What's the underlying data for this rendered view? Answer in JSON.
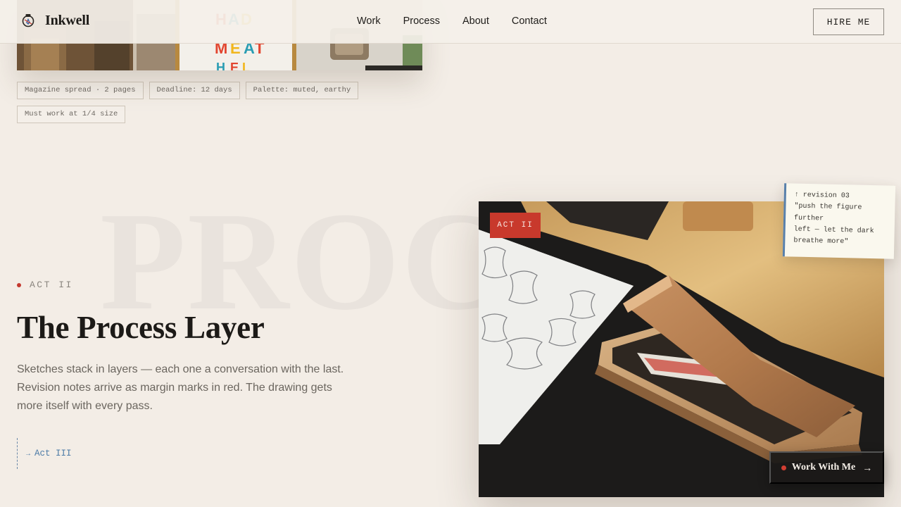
{
  "header": {
    "brand": "Inkwell",
    "logo_icon": "ink-bottle-icon",
    "nav": [
      {
        "label": "Work"
      },
      {
        "label": "Process"
      },
      {
        "label": "About"
      },
      {
        "label": "Contact"
      }
    ],
    "cta_label": "HIRE ME"
  },
  "project_tags": [
    "Magazine spread · 2 pages",
    "Deadline: 12 days",
    "Palette: muted, earthy",
    "Must work at 1/4 size"
  ],
  "poster_text": "HAD\nME AT\nHELLO",
  "section": {
    "watermark": "PROCESS",
    "act_label": "ACT II",
    "title": "The Process Layer",
    "description": "Sketches stack in layers — each one a conversation with the last. Revision notes arrive as margin marks in red. The drawing gets more itself with every pass.",
    "next_link": "Act III",
    "next_arrow": "→"
  },
  "photo": {
    "badge": "ACT II",
    "note": "↑ revision 03\n\"push the figure further\nleft — let the dark breathe more\"",
    "cta_label": "Work With Me",
    "cta_arrow": "→"
  },
  "colors": {
    "background": "#f3ede6",
    "accent_red": "#c8392c",
    "link_blue": "#4c7ba7"
  }
}
